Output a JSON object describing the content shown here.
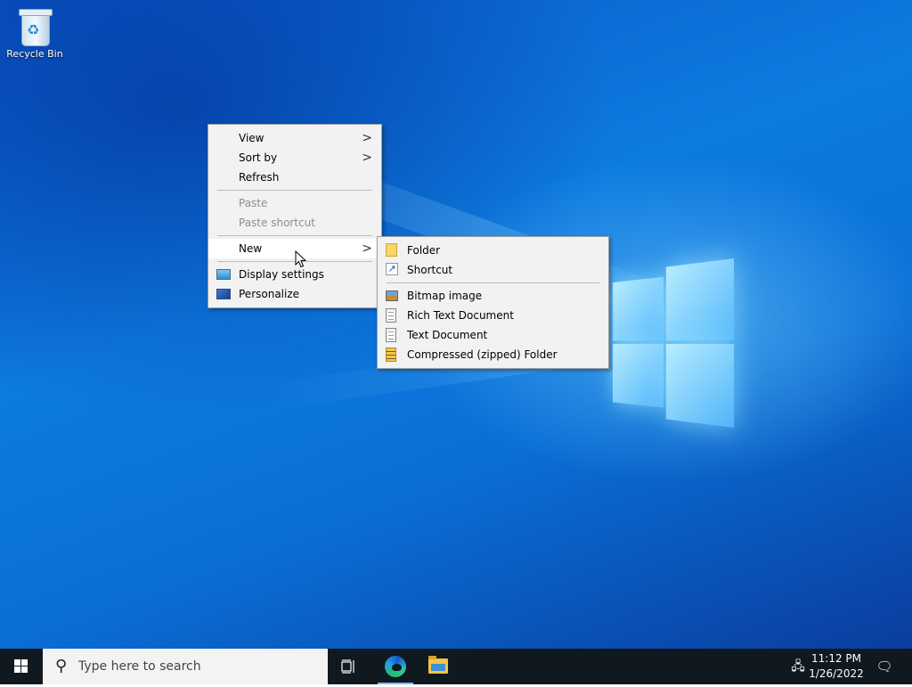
{
  "desktop": {
    "icons": [
      {
        "label": "Recycle Bin",
        "icon": "recycle-bin-icon"
      }
    ]
  },
  "context_menu": {
    "items": [
      {
        "label": "View",
        "has_submenu": true
      },
      {
        "label": "Sort by",
        "has_submenu": true
      },
      {
        "label": "Refresh"
      },
      {
        "label": "Paste",
        "disabled": true
      },
      {
        "label": "Paste shortcut",
        "disabled": true
      },
      {
        "label": "New",
        "has_submenu": true,
        "highlighted": true
      },
      {
        "label": "Display settings",
        "icon": "display-settings-icon"
      },
      {
        "label": "Personalize",
        "icon": "personalize-icon"
      }
    ],
    "submenu_arrow": ">"
  },
  "new_submenu": {
    "items": [
      {
        "label": "Folder",
        "icon": "folder-icon"
      },
      {
        "label": "Shortcut",
        "icon": "shortcut-icon"
      },
      {
        "label": "Bitmap image",
        "icon": "bitmap-image-icon"
      },
      {
        "label": "Rich Text Document",
        "icon": "rich-text-document-icon"
      },
      {
        "label": "Text Document",
        "icon": "text-document-icon"
      },
      {
        "label": "Compressed (zipped) Folder",
        "icon": "zipped-folder-icon"
      }
    ]
  },
  "taskbar": {
    "search_placeholder": "Type here to search",
    "apps": [
      "task-view-icon",
      "edge-icon",
      "file-explorer-icon"
    ],
    "clock": {
      "time": "11:12 PM",
      "date": "1/26/2022"
    }
  },
  "colors": {
    "menu_background": "#f2f2f2",
    "menu_hover": "#ffffff",
    "taskbar_background": "#101820",
    "desktop_accent": "#0d7be0",
    "disabled_text": "#8d8d8d"
  }
}
